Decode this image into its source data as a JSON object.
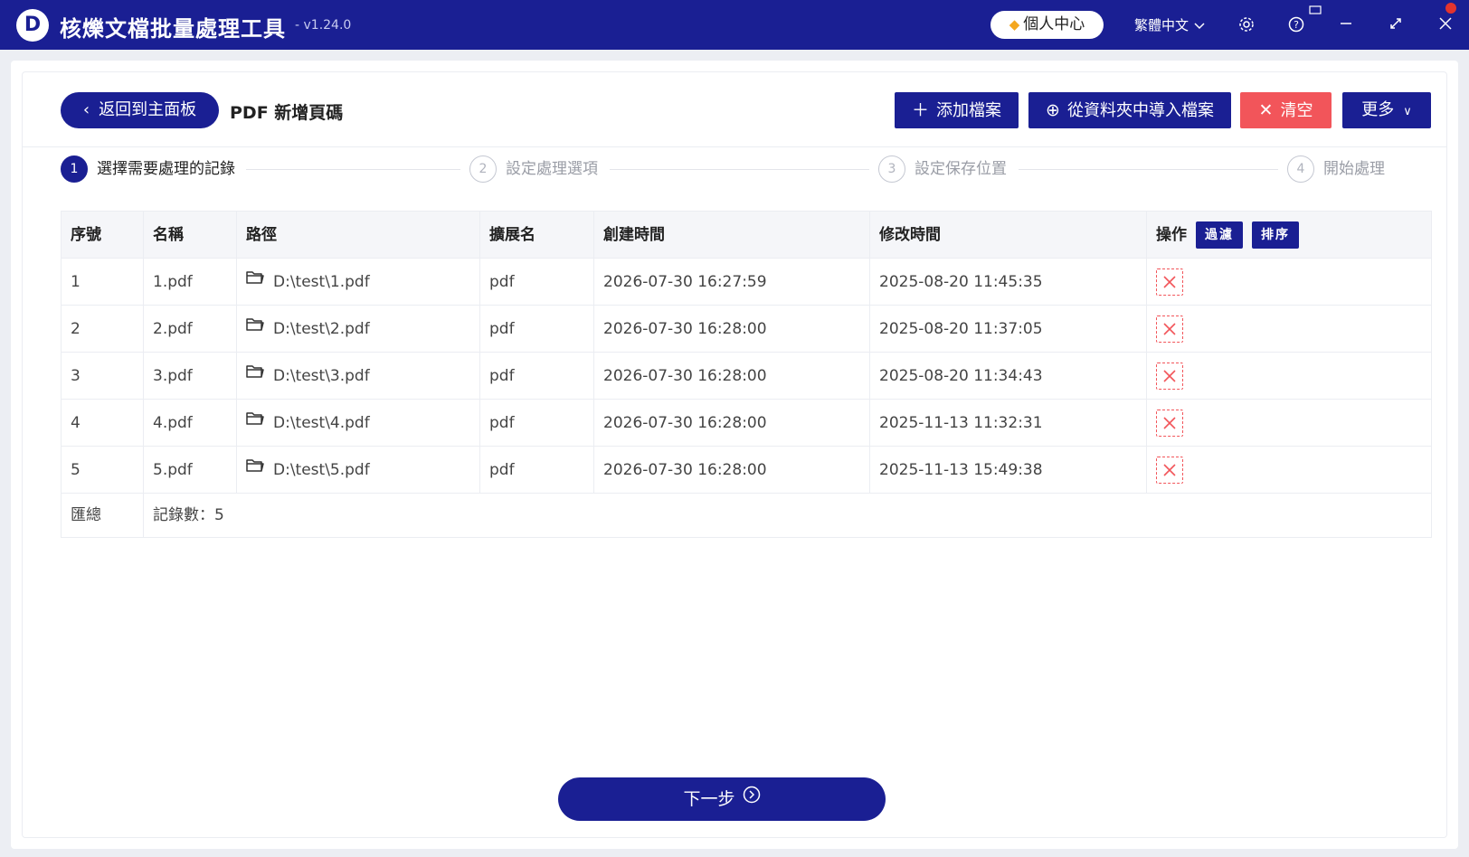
{
  "app": {
    "logo_letter": "D",
    "title": "核爍文檔批量處理工具",
    "version": "- v1.24.0",
    "vip_label": "個人中心",
    "language": "繁體中文"
  },
  "toolbar": {
    "back_label": "返回到主面板",
    "page_title": "PDF 新增頁碼",
    "add_label": "添加檔案",
    "import_label": "從資料夾中導入檔案",
    "clear_label": "清空",
    "more_label": "更多"
  },
  "steps": [
    {
      "num": "1",
      "label": "選擇需要處理的記錄"
    },
    {
      "num": "2",
      "label": "設定處理選項"
    },
    {
      "num": "3",
      "label": "設定保存位置"
    },
    {
      "num": "4",
      "label": "開始處理"
    }
  ],
  "table": {
    "headers": [
      "序號",
      "名稱",
      "路徑",
      "擴展名",
      "創建時間",
      "修改時間",
      "操作"
    ],
    "filter_label": "過濾",
    "sort_label": "排序",
    "rows": [
      {
        "index": "1",
        "name": "1.pdf",
        "path": "D:\\test\\1.pdf",
        "ext": "pdf",
        "created": "2026-07-30 16:27:59",
        "modified": "2025-08-20 11:45:35"
      },
      {
        "index": "2",
        "name": "2.pdf",
        "path": "D:\\test\\2.pdf",
        "ext": "pdf",
        "created": "2026-07-30 16:28:00",
        "modified": "2025-08-20 11:37:05"
      },
      {
        "index": "3",
        "name": "3.pdf",
        "path": "D:\\test\\3.pdf",
        "ext": "pdf",
        "created": "2026-07-30 16:28:00",
        "modified": "2025-08-20 11:34:43"
      },
      {
        "index": "4",
        "name": "4.pdf",
        "path": "D:\\test\\4.pdf",
        "ext": "pdf",
        "created": "2026-07-30 16:28:00",
        "modified": "2025-11-13 11:32:31"
      },
      {
        "index": "5",
        "name": "5.pdf",
        "path": "D:\\test\\5.pdf",
        "ext": "pdf",
        "created": "2026-07-30 16:28:00",
        "modified": "2025-11-13 15:49:38"
      }
    ],
    "footer_label": "匯總",
    "footer_count": "記錄數：5"
  },
  "next_label": "下一步",
  "colors": {
    "primary": "#1a1f93",
    "danger": "#f2555a",
    "vip": "#f4a71f"
  }
}
